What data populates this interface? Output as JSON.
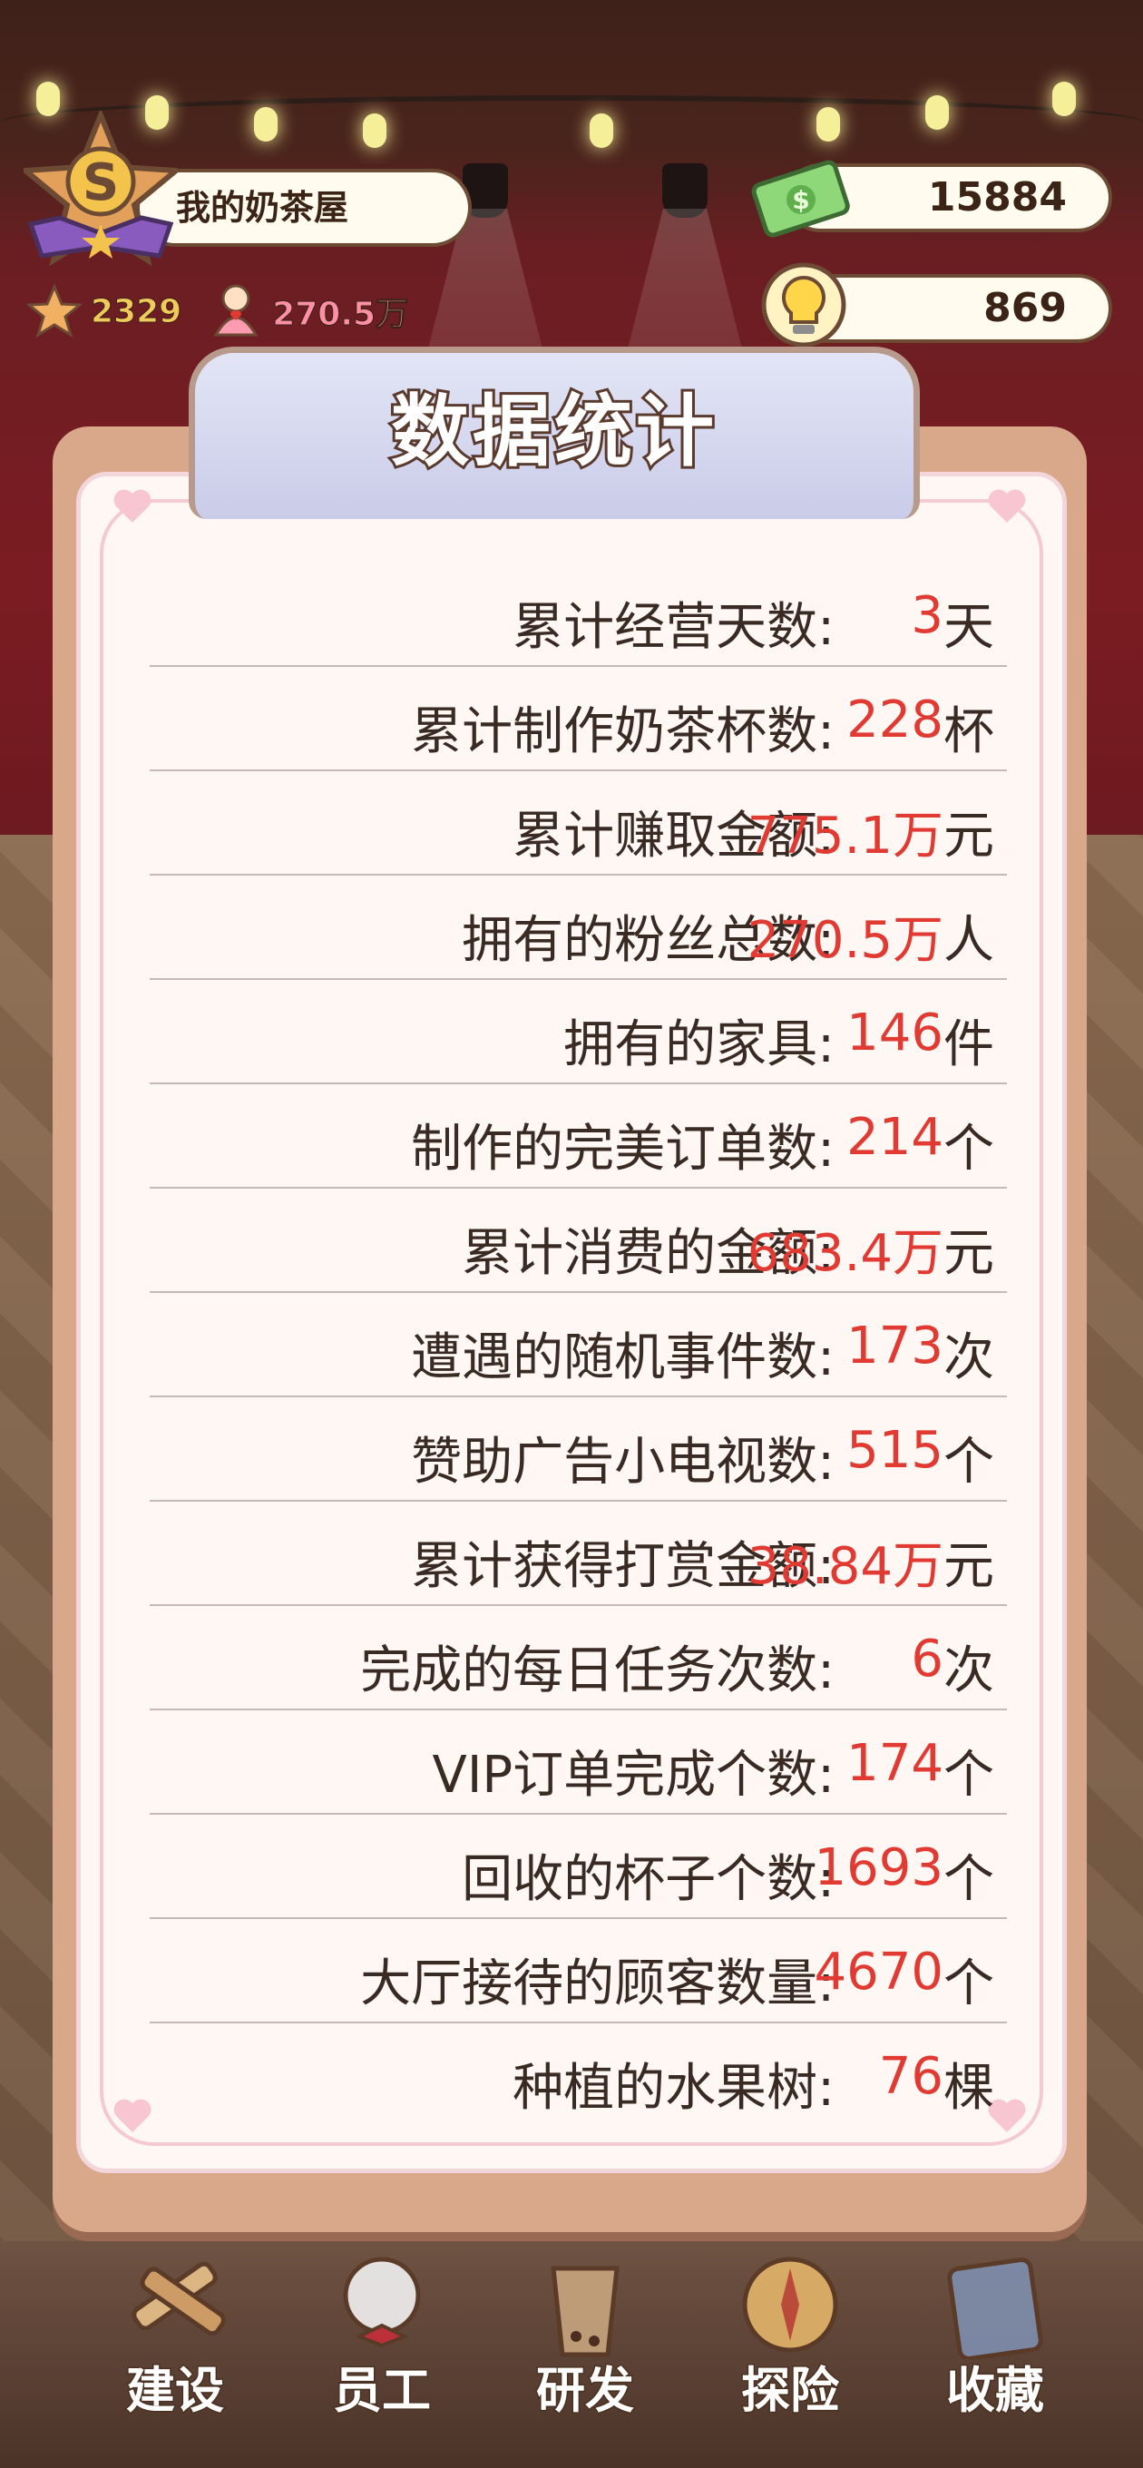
{
  "hud": {
    "rank_letter": "S",
    "shop_name": "我的奶茶屋",
    "star_count": "2329",
    "fan_count": "270.5万",
    "money": "15884",
    "ideas": "869"
  },
  "panel": {
    "title": "数据统计",
    "rows": [
      {
        "label": "累计经营天数:",
        "value": "3",
        "unit": "天"
      },
      {
        "label": "累计制作奶茶杯数:",
        "value": "228",
        "unit": "杯"
      },
      {
        "label": "累计赚取金额:",
        "value": "775.1万",
        "unit": "元"
      },
      {
        "label": "拥有的粉丝总数:",
        "value": "270.5万",
        "unit": "人"
      },
      {
        "label": "拥有的家具:",
        "value": "146",
        "unit": "件"
      },
      {
        "label": "制作的完美订单数:",
        "value": "214",
        "unit": "个"
      },
      {
        "label": "累计消费的金额:",
        "value": "683.4万",
        "unit": "元"
      },
      {
        "label": "遭遇的随机事件数:",
        "value": "173",
        "unit": "次"
      },
      {
        "label": "赞助广告小电视数:",
        "value": "515",
        "unit": "个"
      },
      {
        "label": "累计获得打赏金额:",
        "value": "38.84万",
        "unit": "元"
      },
      {
        "label": "完成的每日任务次数:",
        "value": "6",
        "unit": "次"
      },
      {
        "label": "VIP订单完成个数:",
        "value": "174",
        "unit": "个"
      },
      {
        "label": "回收的杯子个数:",
        "value": "1693",
        "unit": "个"
      },
      {
        "label": "大厅接待的顾客数量:",
        "value": "4670",
        "unit": "个"
      },
      {
        "label": "种植的水果树:",
        "value": "76",
        "unit": "棵"
      }
    ]
  },
  "nav": {
    "build": "建设",
    "staff": "员工",
    "research": "研发",
    "explore": "探险",
    "collection": "收藏"
  },
  "colors": {
    "value_red": "#e13a32",
    "label_dark": "#3a2a24",
    "panel_bg": "#fff7f4",
    "title_tab": "#c9cce8"
  }
}
